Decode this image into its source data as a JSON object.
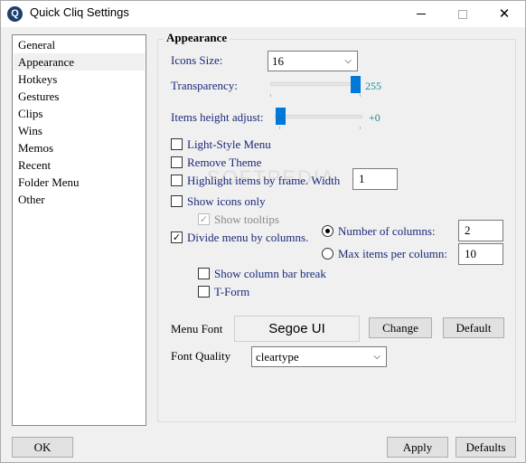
{
  "window": {
    "title": "Quick Cliq Settings",
    "app_icon_letter": "Q",
    "minimize_icon": "minimize-icon",
    "maximize_icon": "maximize-icon",
    "close_icon": "close-icon",
    "close_glyph": "✕"
  },
  "nav": {
    "items": [
      {
        "label": "General"
      },
      {
        "label": "Appearance",
        "selected": true
      },
      {
        "label": "Hotkeys"
      },
      {
        "label": "Gestures"
      },
      {
        "label": "Clips"
      },
      {
        "label": "Wins"
      },
      {
        "label": "Memos"
      },
      {
        "label": "Recent"
      },
      {
        "label": "Folder Menu"
      },
      {
        "label": "Other"
      }
    ]
  },
  "appearance": {
    "group_title": "Appearance",
    "icons_size": {
      "label": "Icons Size:",
      "value": "16"
    },
    "transparency": {
      "label": "Transparency:",
      "value": "255",
      "level": 1.0
    },
    "items_height": {
      "label": "Items height adjust:",
      "value": "+0",
      "level": 0.0
    },
    "light_style": {
      "label": "Light-Style Menu",
      "checked": false
    },
    "remove_theme": {
      "label": "Remove Theme",
      "checked": false
    },
    "highlight_frame": {
      "label": "Highlight items by frame. Width",
      "checked": false,
      "width_value": "1"
    },
    "show_icons_only": {
      "label": "Show icons only",
      "checked": false
    },
    "show_tooltips": {
      "label": "Show tooltips",
      "checked": true,
      "disabled": true
    },
    "divide_columns": {
      "label": "Divide menu by columns.",
      "checked": true,
      "check_glyph": "✓"
    },
    "number_of_columns": {
      "label": "Number of columns:",
      "selected": true,
      "value": "2"
    },
    "max_items_per_column": {
      "label": "Max items per column:",
      "selected": false,
      "value": "10"
    },
    "show_column_bar_break": {
      "label": "Show column bar break",
      "checked": false
    },
    "t_form": {
      "label": "T-Form",
      "checked": false
    },
    "menu_font": {
      "label": "Menu Font",
      "preview": "Segoe UI",
      "change_label": "Change",
      "default_label": "Default"
    },
    "font_quality": {
      "label": "Font Quality",
      "value": "cleartype"
    },
    "dropdown_glyph": "⌵"
  },
  "footer": {
    "ok_label": "OK",
    "apply_label": "Apply",
    "defaults_label": "Defaults"
  },
  "watermark": "SOFTPEDIA",
  "colors": {
    "slider_thumb": "#0078d7",
    "slider_value_text": "#1a8a8a",
    "label_blue": "#1a2a7a"
  }
}
